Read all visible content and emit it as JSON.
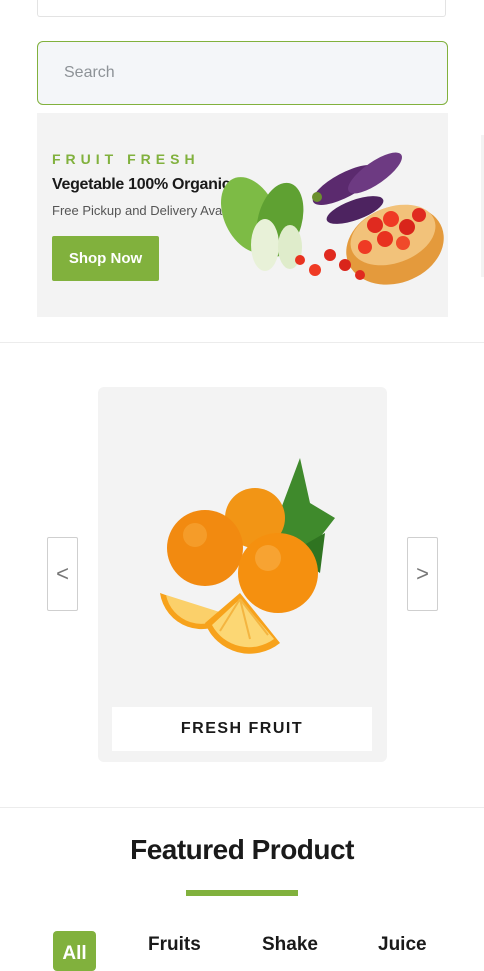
{
  "search": {
    "placeholder": "Search"
  },
  "banner": {
    "kicker": "FRUIT FRESH",
    "title": "Vegetable 100% Organic",
    "subtitle": "Free Pickup and Delivery Available",
    "button_label": "Shop Now"
  },
  "carousel": {
    "prev_label": "<",
    "next_label": ">",
    "slide_caption": "FRESH FRUIT"
  },
  "featured": {
    "title": "Featured Product",
    "tabs": [
      {
        "label": "All",
        "active": true
      },
      {
        "label": "Fruits",
        "active": false
      },
      {
        "label": "Shake",
        "active": false
      },
      {
        "label": "Juice",
        "active": false
      }
    ]
  },
  "colors": {
    "accent": "#81b13d",
    "banner_bg": "#f3f3f3",
    "search_bg": "#f4f6f9"
  }
}
